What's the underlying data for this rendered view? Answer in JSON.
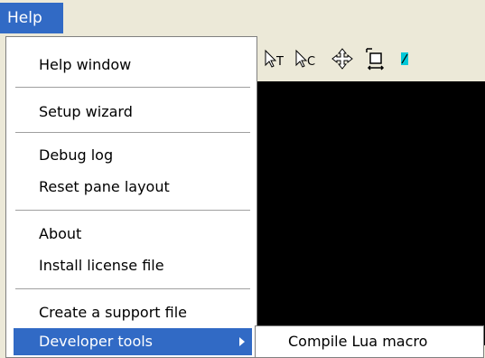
{
  "menubar": {
    "help_label": "Help"
  },
  "toolbar": {
    "tools": [
      {
        "label": "T",
        "icon": "text-select-cursor-icon"
      },
      {
        "label": "C",
        "icon": "comment-select-cursor-icon"
      },
      {
        "icon": "move-arrows-icon"
      },
      {
        "icon": "resize-crop-icon"
      },
      {
        "icon": "highlight-marker-icon",
        "color": "#00c8d8"
      }
    ]
  },
  "help_menu": {
    "items": [
      {
        "label": "Help window"
      },
      {
        "label": "Setup wizard"
      },
      {
        "label": "Debug log"
      },
      {
        "label": "Reset pane layout"
      },
      {
        "label": "About"
      },
      {
        "label": "Install license file"
      },
      {
        "label": "Create a support file"
      },
      {
        "label": "Developer tools",
        "highlighted": true,
        "has_submenu": true
      }
    ]
  },
  "developer_submenu": {
    "items": [
      {
        "label": "Compile Lua macro"
      }
    ]
  },
  "colors": {
    "highlight": "#316ac5",
    "menubar": "#ece9d8",
    "pane": "#000000"
  }
}
